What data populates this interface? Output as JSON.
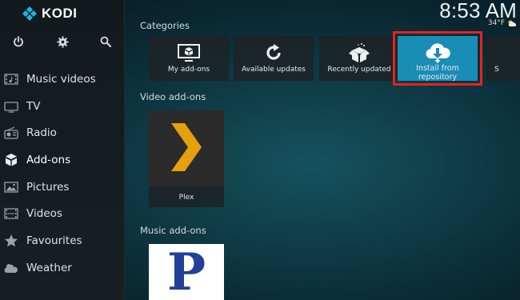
{
  "app": {
    "name": "KODI"
  },
  "header": {
    "time": "8:53 AM",
    "temperature": "34°F",
    "weather_icon": "partly-cloudy-icon"
  },
  "sidebar": {
    "top_icons": [
      {
        "name": "power-icon"
      },
      {
        "name": "gear-icon"
      },
      {
        "name": "search-icon"
      }
    ],
    "items": [
      {
        "label": "Music videos",
        "icon": "music-video-icon"
      },
      {
        "label": "TV",
        "icon": "tv-icon"
      },
      {
        "label": "Radio",
        "icon": "radio-icon"
      },
      {
        "label": "Add-ons",
        "icon": "addons-box-icon",
        "active": true
      },
      {
        "label": "Pictures",
        "icon": "pictures-icon"
      },
      {
        "label": "Videos",
        "icon": "film-icon"
      },
      {
        "label": "Favourites",
        "icon": "star-icon"
      },
      {
        "label": "Weather",
        "icon": "cloud-icon"
      }
    ]
  },
  "categories": {
    "title": "Categories",
    "tiles": [
      {
        "label": "My add-ons",
        "icon": "monitor-box-icon"
      },
      {
        "label": "Available updates",
        "icon": "refresh-icon"
      },
      {
        "label": "Recently updated",
        "icon": "open-box-icon"
      },
      {
        "label_line1": "Install from",
        "label_line2": "repository",
        "icon": "cloud-download-icon",
        "selected": true
      },
      {
        "label": "S",
        "icon": ""
      }
    ]
  },
  "video_addons": {
    "title": "Video add-ons",
    "items": [
      {
        "label": "Plex",
        "icon": "plex-chevron-icon"
      }
    ]
  },
  "music_addons": {
    "title": "Music add-ons",
    "items": [
      {
        "label": "P",
        "icon": "pandora-logo-icon"
      }
    ]
  },
  "colors": {
    "selected_tile": "#1a8db7",
    "highlight_outline": "#e5231f",
    "plex_orange": "#e5a00d"
  }
}
